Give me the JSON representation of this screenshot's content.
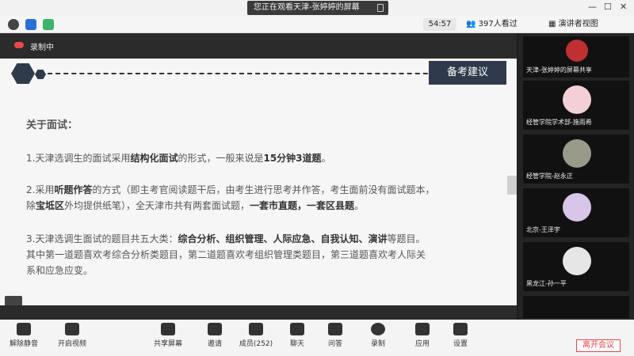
{
  "window": {
    "title": "您正在观看天津-张婷婷的屏幕"
  },
  "toolbar": {
    "timer": "54:57",
    "viewers": "397人看过",
    "view_mode": "演讲者视图"
  },
  "recording": {
    "label": "录制中"
  },
  "slide": {
    "badge": "备考建议",
    "heading": "关于面试：",
    "p1a": "1.天津选调生的面试采用",
    "p1b": "结构化面试",
    "p1c": "的形式，一般来说是",
    "p1d": "15分钟3道题",
    "p1e": "。",
    "p2a": "2.采用",
    "p2b": "听题作答",
    "p2c": "的方式（即主考官阅读题干后，由考生进行思考并作答，考生面前没有面试题本，",
    "p2d": "除",
    "p2e": "宝坻区",
    "p2f": "外均提供纸笔），全天津市共有两套面试题，",
    "p2g": "一套市直题，一套区县题",
    "p2h": "。",
    "p3a": "3.天津选调生面试的题目共五大类：",
    "p3b": "综合分析、组织管理、人际应急、自我认知、演讲",
    "p3c": "等题目。",
    "p3d": "其中第一道题喜欢考综合分析类题目，第二道题喜欢考组织管理类题目，第三道题喜欢考人际关",
    "p3e": "系和应急应变。"
  },
  "participants": [
    {
      "name": "天津-张婷婷的屏幕共享"
    },
    {
      "name": "经管学院学术部-施雨希"
    },
    {
      "name": "经管学院-赵永正"
    },
    {
      "name": "北京-王泽宇"
    },
    {
      "name": "黑龙江-孙一平"
    }
  ],
  "bottom_bar": {
    "unmute": "解除静音",
    "start_video": "开启视频",
    "share_screen": "共享屏幕",
    "invite": "邀请",
    "members": "成员(252)",
    "chat": "聊天",
    "qa": "问答",
    "record": "录制",
    "apps": "应用",
    "settings": "设置",
    "leave": "离开会议"
  }
}
